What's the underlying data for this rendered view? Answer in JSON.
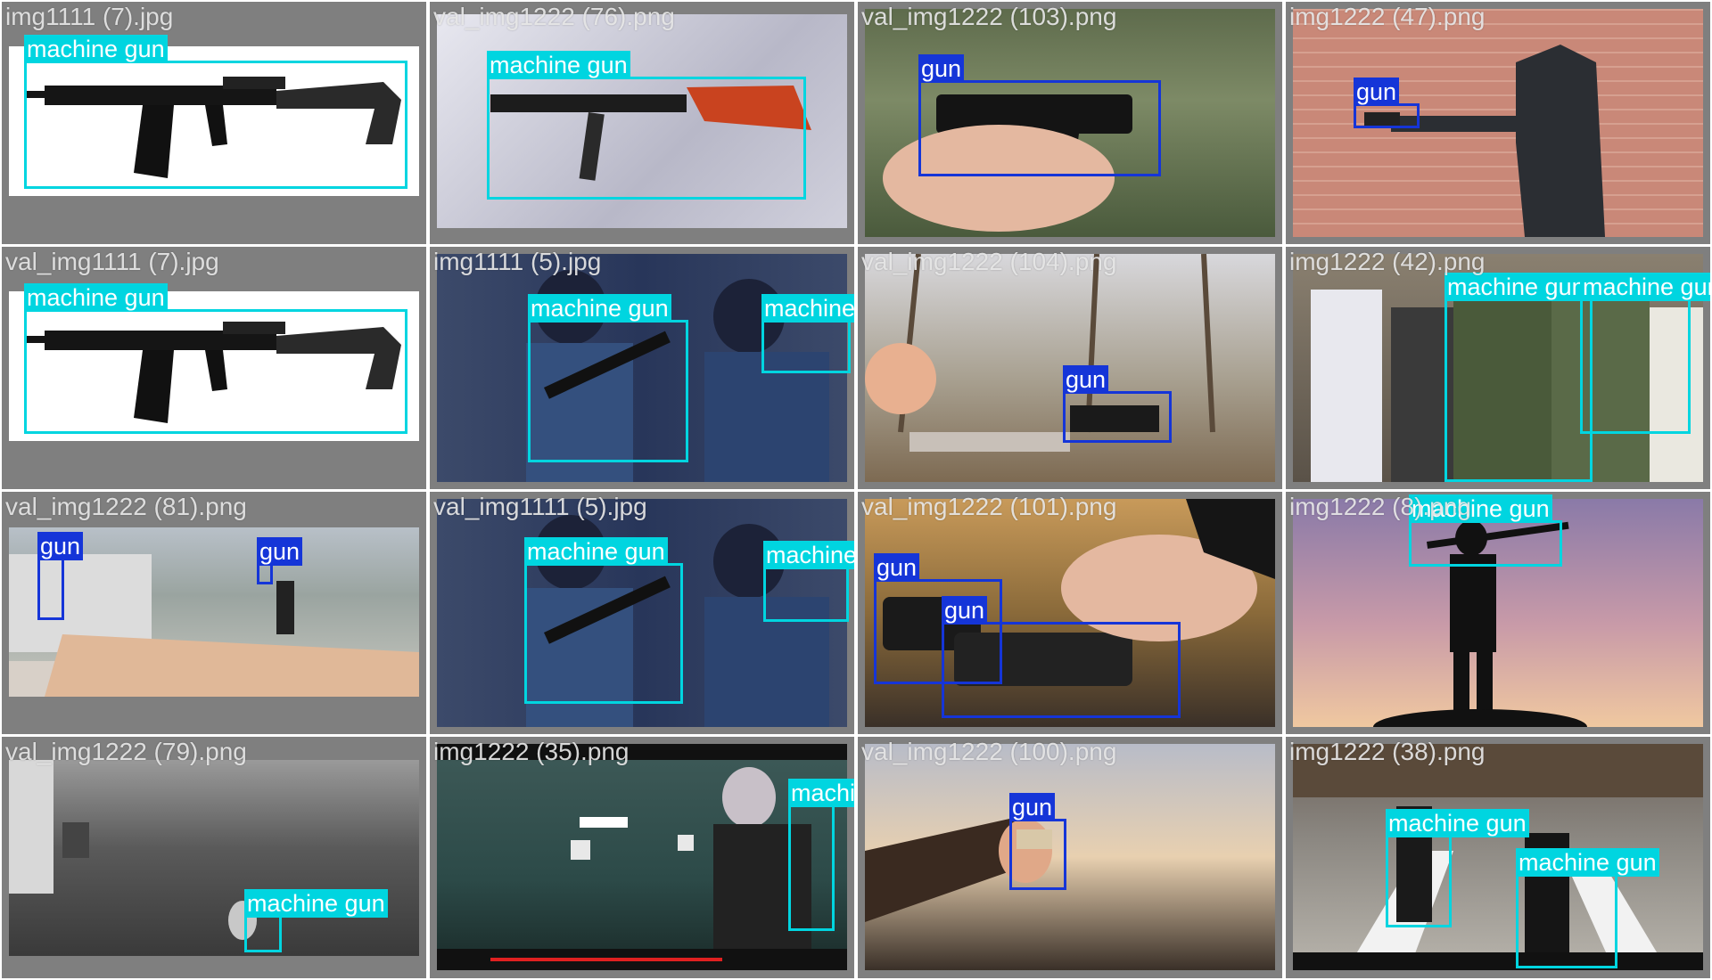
{
  "colors": {
    "tile_bg": "#7f7f7f",
    "machine_gun": "#00d5e0",
    "gun": "#1535d8",
    "filename_text": "#e6e6e6"
  },
  "labels": {
    "machine_gun": "machine gun",
    "gun": "gun"
  },
  "tiles": [
    {
      "filename": "img1111 (7).jpg"
    },
    {
      "filename": "val_img1222 (76).png"
    },
    {
      "filename": "val_img1222 (103).png"
    },
    {
      "filename": "img1222 (47).png"
    },
    {
      "filename": "val_img1111 (7).jpg"
    },
    {
      "filename": "img1111 (5).jpg"
    },
    {
      "filename": "val_img1222 (104).png"
    },
    {
      "filename": "img1222 (42).png"
    },
    {
      "filename": "val_img1222 (81).png"
    },
    {
      "filename": "val_img1111 (5).jpg"
    },
    {
      "filename": "val_img1222 (101).png"
    },
    {
      "filename": "img1222 (8).png"
    },
    {
      "filename": "val_img1222 (79).png"
    },
    {
      "filename": "img1222 (35).png"
    },
    {
      "filename": "val_img1222 (100).png"
    },
    {
      "filename": "img1222 (38).png"
    }
  ]
}
